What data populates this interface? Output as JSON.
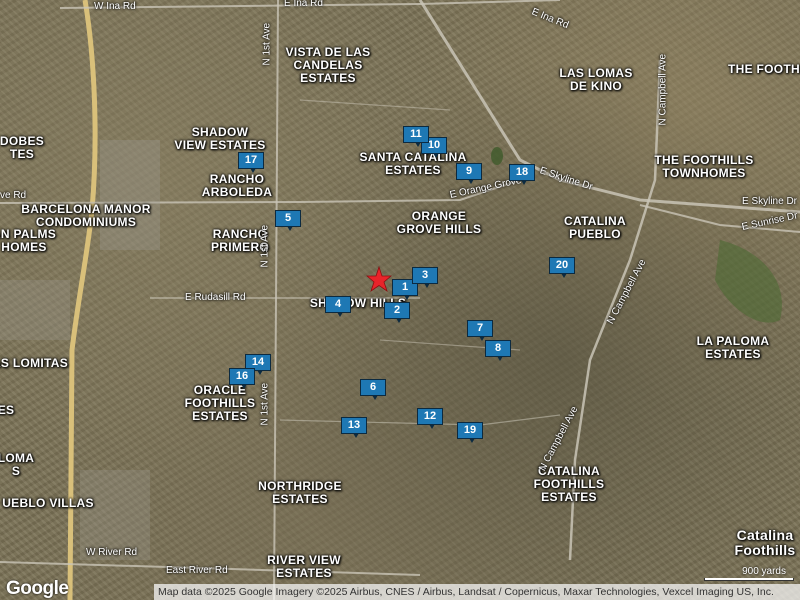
{
  "area_labels": [
    {
      "id": "vista-de-las-candelas",
      "text": "VISTA DE LAS\nCANDELAS\nESTATES"
    },
    {
      "id": "las-lomas-de-kino",
      "text": "LAS LOMAS\nDE KINO"
    },
    {
      "id": "the-footh",
      "text": "THE FOOTH"
    },
    {
      "id": "shadow-view-estates",
      "text": "SHADOW\nVIEW ESTATES"
    },
    {
      "id": "santa-catalina-estates",
      "text": "SANTA CATALINA\nESTATES"
    },
    {
      "id": "the-foothills-townhomes",
      "text": "THE FOOTHILLS\nTOWNHOMES"
    },
    {
      "id": "rancho-arboleda",
      "text": "RANCHO\nARBOLEDA"
    },
    {
      "id": "dobes",
      "text": "DOBES\nTES"
    },
    {
      "id": "barcelona-manor",
      "text": "BARCELONA MANOR\nCONDOMINIUMS"
    },
    {
      "id": "orange-grove-hills",
      "text": "ORANGE\nGROVE HILLS"
    },
    {
      "id": "catalina-pueblo",
      "text": "CATALINA\nPUEBLO"
    },
    {
      "id": "an-palms",
      "text": "AN PALMS\nHOMES"
    },
    {
      "id": "rancho-primero",
      "text": "RANCHO\nPRIMERO"
    },
    {
      "id": "shadow-hills",
      "text": "SHADOW HILLS"
    },
    {
      "id": "la-paloma-estates",
      "text": "LA PALOMA\nESTATES"
    },
    {
      "id": "as-lomitas",
      "text": "AS LOMITAS"
    },
    {
      "id": "oracle-foothills",
      "text": "ORACLE\nFOOTHILLS\nESTATES"
    },
    {
      "id": "es",
      "text": "ES"
    },
    {
      "id": "loma",
      "text": "LOMA\nS"
    },
    {
      "id": "catalina-foothills-estates",
      "text": "CATALINA\nFOOTHILLS\nESTATES"
    },
    {
      "id": "northridge-estates",
      "text": "NORTHRIDGE\nESTATES"
    },
    {
      "id": "pueblo-villas",
      "text": "UEBLO VILLAS"
    },
    {
      "id": "river-view-estates",
      "text": "RIVER VIEW\nESTATES"
    },
    {
      "id": "catalina-foothills",
      "text": "Catalina\nFoothills"
    }
  ],
  "road_labels": [
    {
      "id": "w-ina-rd",
      "text": "W Ina Rd"
    },
    {
      "id": "e-ina-rd",
      "text": "E Ina Rd"
    },
    {
      "id": "e-ina-rd-2",
      "text": "E Ina Rd"
    },
    {
      "id": "n-1st-ave-top",
      "text": "N 1st Ave"
    },
    {
      "id": "n-campbell-ave-top",
      "text": "N Campbell Ave"
    },
    {
      "id": "e-skyline-dr",
      "text": "E Skyline Dr"
    },
    {
      "id": "e-skyline-dr-right",
      "text": "E Skyline Dr"
    },
    {
      "id": "e-orange-grove",
      "text": "E Orange Grove"
    },
    {
      "id": "ve-rd",
      "text": "ve Rd"
    },
    {
      "id": "e-sunrise-dr",
      "text": "E Sunrise Dr"
    },
    {
      "id": "n-1st-ave-mid",
      "text": "N 1st Ave"
    },
    {
      "id": "e-rudasill-rd",
      "text": "E Rudasill Rd"
    },
    {
      "id": "n-campbell-ave-mid",
      "text": "N Campbell Ave"
    },
    {
      "id": "n-1st-ave-low",
      "text": "N 1st Ave"
    },
    {
      "id": "n-campbell-ave-low",
      "text": "N Campbell Ave"
    },
    {
      "id": "w-river-rd",
      "text": "W River Rd"
    },
    {
      "id": "east-river-rd",
      "text": "East River Rd"
    }
  ],
  "markers": [
    {
      "id": "marker-1",
      "label": "1"
    },
    {
      "id": "marker-2",
      "label": "2"
    },
    {
      "id": "marker-3",
      "label": "3"
    },
    {
      "id": "marker-4",
      "label": "4"
    },
    {
      "id": "marker-5",
      "label": "5"
    },
    {
      "id": "marker-6",
      "label": "6"
    },
    {
      "id": "marker-7",
      "label": "7"
    },
    {
      "id": "marker-8",
      "label": "8"
    },
    {
      "id": "marker-9",
      "label": "9"
    },
    {
      "id": "marker-10",
      "label": "10"
    },
    {
      "id": "marker-11",
      "label": "11"
    },
    {
      "id": "marker-12",
      "label": "12"
    },
    {
      "id": "marker-13",
      "label": "13"
    },
    {
      "id": "marker-14",
      "label": "14"
    },
    {
      "id": "marker-16",
      "label": "16"
    },
    {
      "id": "marker-17",
      "label": "17"
    },
    {
      "id": "marker-18",
      "label": "18"
    },
    {
      "id": "marker-19",
      "label": "19"
    },
    {
      "id": "marker-20",
      "label": "20"
    }
  ],
  "center_marker": {
    "icon": "star-icon",
    "color": "#e8242a"
  },
  "logo": "Google",
  "attribution": "Map data ©2025 Google Imagery ©2025 Airbus, CNES / Airbus, Landsat / Copernicus, Maxar Technologies, Vexcel Imaging US, Inc.",
  "scale": "900 yards",
  "colors": {
    "marker": "#1e78b4",
    "highway": "#d9c07a",
    "road": "#c9c4b6"
  }
}
